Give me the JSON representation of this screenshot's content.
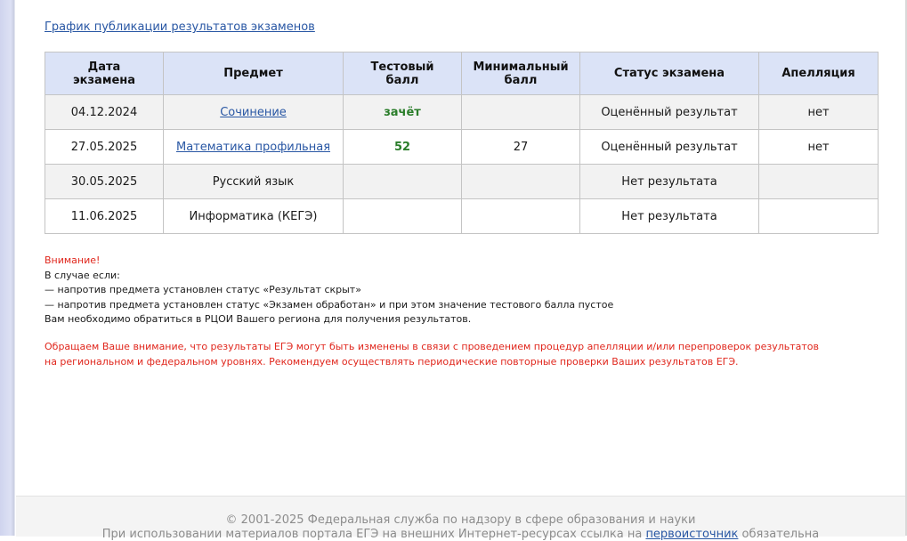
{
  "schedule_link": "График публикации результатов экзаменов",
  "table": {
    "headers": [
      [
        "Дата",
        "экзамена"
      ],
      [
        "Предмет"
      ],
      [
        "Тестовый",
        "балл"
      ],
      [
        "Минимальный",
        "балл"
      ],
      [
        "Статус экзамена"
      ],
      [
        "Апелляция"
      ]
    ],
    "rows": [
      {
        "date": "04.12.2024",
        "subject": "Сочинение",
        "subject_link": true,
        "score": "зачёт",
        "min_score": "",
        "status": "Оценённый результат",
        "appeal": "нет"
      },
      {
        "date": "27.05.2025",
        "subject": "Математика профильная",
        "subject_link": true,
        "score": "52",
        "min_score": "27",
        "status": "Оценённый результат",
        "appeal": "нет"
      },
      {
        "date": "30.05.2025",
        "subject": "Русский язык",
        "subject_link": false,
        "score": "",
        "min_score": "",
        "status": "Нет результата",
        "appeal": ""
      },
      {
        "date": "11.06.2025",
        "subject": "Информатика (КЕГЭ)",
        "subject_link": false,
        "score": "",
        "min_score": "",
        "status": "Нет результата",
        "appeal": ""
      }
    ]
  },
  "notice": {
    "title": "Внимание!",
    "lines": [
      "В случае если:",
      "— напротив предмета установлен статус «Результат скрыт»",
      "— напротив предмета установлен статус «Экзамен обработан» и при этом значение тестового балла пустое",
      "Вам необходимо обратиться в РЦОИ Вашего региона для получения результатов."
    ]
  },
  "warning": "Обращаем Ваше внимание, что результаты ЕГЭ могут быть изменены в связи с проведением процедур апелляции и/или перепроверок результатов на региональном и федеральном уровнях. Рекомендуем осуществлять периодические повторные проверки Ваших результатов ЕГЭ.",
  "footer": {
    "copyright": "© 2001-2025 Федеральная служба по надзору в сфере образования и науки",
    "usage_before": "При использовании материалов портала ЕГЭ на внешних Интернет-ресурсах ссылка на ",
    "usage_link": "первоисточник",
    "usage_after": " обязательна"
  },
  "colors": {
    "link": "#2957a4",
    "score_green": "#2a7d2a",
    "warning_red": "#e0261c",
    "header_bg": "#dbe3f7"
  }
}
